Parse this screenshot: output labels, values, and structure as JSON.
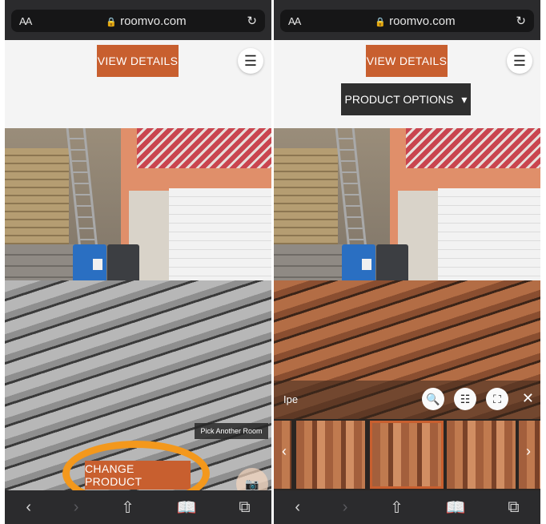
{
  "browser": {
    "text_size_label": "AA",
    "url": "roomvo.com"
  },
  "left_screen": {
    "view_details_label": "VIEW DETAILS",
    "pick_room_label": "Pick Another Room",
    "change_product_label": "CHANGE PRODUCT"
  },
  "right_screen": {
    "view_details_label": "VIEW DETAILS",
    "product_options_label": "PRODUCT OPTIONS",
    "product_name": "Ipe"
  },
  "icons": [
    "lock-icon",
    "reload-icon",
    "menu-icon",
    "back-icon",
    "forward-icon",
    "share-icon",
    "bookmarks-icon",
    "tabs-icon",
    "search-icon",
    "filter-icon",
    "fullscreen-icon",
    "close-icon",
    "camera-icon",
    "chevron-left-icon",
    "chevron-right-icon"
  ],
  "colors": {
    "accent": "#c85f2f",
    "highlight_circle": "#f3981c",
    "browser_chrome": "#2b2b2d"
  }
}
